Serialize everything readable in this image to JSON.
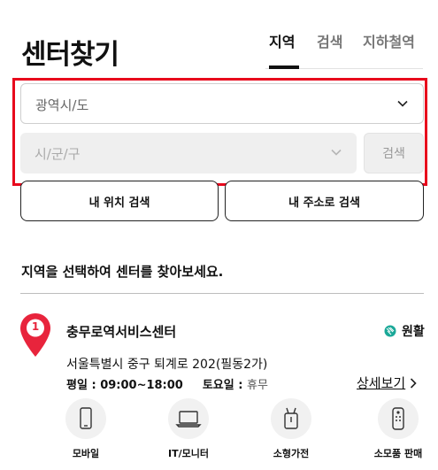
{
  "header": {
    "title": "센터찾기"
  },
  "tabs": [
    {
      "label": "지역",
      "active": true
    },
    {
      "label": "검색",
      "active": false
    },
    {
      "label": "지하철역",
      "active": false
    }
  ],
  "filters": {
    "region_placeholder": "광역시/도",
    "district_placeholder": "시/군/구",
    "search_label": "검색"
  },
  "location_buttons": {
    "my_location": "내 위치 검색",
    "my_address": "내 주소로 검색"
  },
  "guide_text": "지역을 선택하여 센터를 찾아보세요.",
  "center": {
    "rank": "1",
    "name": "충무로역서비스센터",
    "status": "원활",
    "address": "서울특별시 중구 퇴계로 202(필동2가)",
    "weekday_label": "평일",
    "weekday_hours": "09:00~18:00",
    "saturday_label": "토요일",
    "saturday_hours": "휴무",
    "detail_label": "상세보기",
    "services": [
      {
        "label": "모바일",
        "icon": "mobile-icon"
      },
      {
        "label": "IT/모니터",
        "icon": "laptop-icon"
      },
      {
        "label": "소형가전",
        "icon": "small-appliance-icon"
      },
      {
        "label": "소모품 판매",
        "icon": "remote-icon"
      }
    ]
  },
  "colors": {
    "accent": "#e8243c",
    "highlight": "#e8081c",
    "status": "#1aa898"
  }
}
